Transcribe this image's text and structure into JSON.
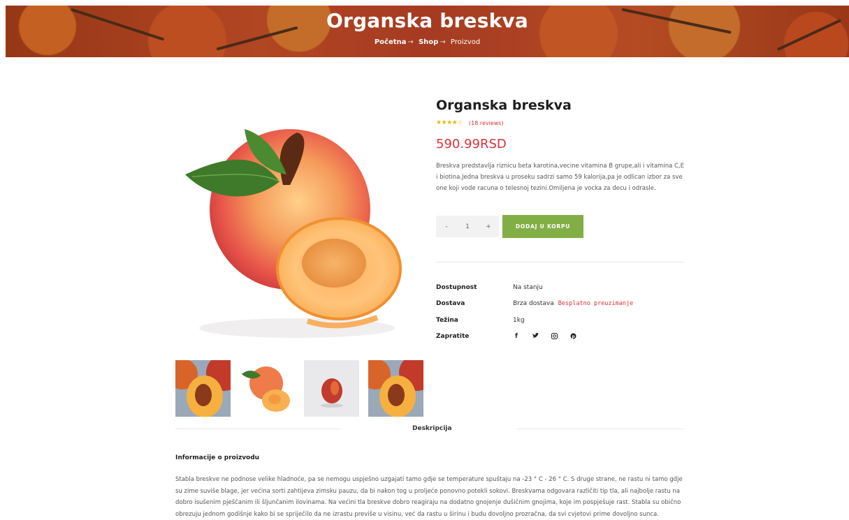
{
  "header": {
    "title": "Organska breskva",
    "breadcrumbs": {
      "home": "Početna",
      "shop": "Shop",
      "current": "Proizvod",
      "separator": "→"
    }
  },
  "product": {
    "title": "Organska breskva",
    "rating_stars": "★★★★☆",
    "reviews": "(18 reviews)",
    "price": "590.99RSD",
    "description": "Breskva predstavlja riznicu beta karotina,vecine vitamina B grupe,ali i vitamina C,E i biotina.Jedna breskva u proseku sadrzi samo 59 kalorija,pa je odlican izbor za sve one koji vode racuna o telesnoj tezini.Omiljena je vocka za decu i odrasle.",
    "quantity": {
      "minus": "-",
      "value": "1",
      "plus": "+"
    },
    "add_to_cart": "DODAJ U KORPU"
  },
  "meta": {
    "availability_label": "Dostupnost",
    "availability_value": "Na stanju",
    "shipping_label": "Dostava",
    "shipping_value": "Brza dostava",
    "shipping_extra": "Besplatno preuzimanje",
    "weight_label": "Težina",
    "weight_value": "1kg",
    "follow_label": "Zapratite",
    "socials": [
      "facebook-icon",
      "twitter-icon",
      "instagram-icon",
      "pinterest-icon"
    ]
  },
  "tabs": {
    "description": "Deskripcija"
  },
  "info": {
    "title": "Informacije o proizvodu",
    "body": "Stabla breskve ne podnose velike hladnoće, pa se nemogu uspješno uzgajati tamo gdje se temperature spuštaju na -23 ° C - 26 ° C. S druge strane, ne rastu ni tamo gdje su zime suviše blage, jer većina sorti zahtijeva zimsku pauzu, da bi nakon tog u proljeće ponovno potekli sokovi. Breskvama odgovara različiti tip tla, ali najbolje rastu na dobro isušenim pješčanim ili šljunčanim ilovinama. Na većini tla breskve dobro reagiraju na dodatno gnojenje dušičnim gnojima, koje im pospješuje rast. Stabla su obično obrezuju jednom godišnje kako bi se spriječilo da ne izrastu previše u visinu, već da rastu u širinu i budu dovoljno prozračna, da svi cvjetovi prime dovoljno sunca."
  },
  "colors": {
    "accent_green": "#82ae46",
    "price_red": "#d9323a",
    "star_gold": "#f0b400"
  }
}
